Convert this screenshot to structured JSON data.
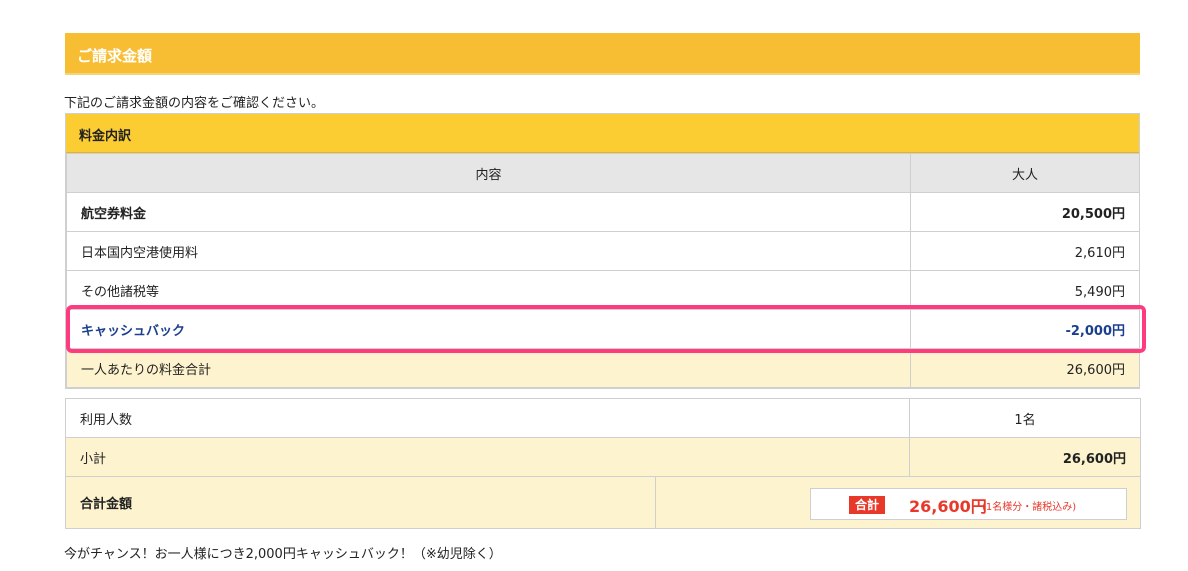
{
  "header": {
    "title": "ご請求金額"
  },
  "intro": "下記のご請求金額の内容をご確認ください。",
  "breakdown": {
    "section_title": "料金内訳",
    "col_content": "内容",
    "col_adult": "大人",
    "rows": [
      {
        "label": "航空券料金",
        "value": "20,500円"
      },
      {
        "label": "日本国内空港使用料",
        "value": "2,610円"
      },
      {
        "label": "その他諸税等",
        "value": "5,490円"
      },
      {
        "label": "キャッシュバック",
        "value": "-2,000円"
      },
      {
        "label": "一人あたりの料金合計",
        "value": "26,600円"
      }
    ]
  },
  "summary": {
    "count_label": "利用人数",
    "count_value": "1名",
    "subtotal_label": "小計",
    "subtotal_value": "26,600円",
    "grand_label": "合計金額",
    "grand_badge": "合計",
    "grand_amount": "26,600円",
    "grand_note": "(1名様分・諸税込み)"
  },
  "footer_note": "今がチャンス！お一人様につき2,000円キャッシュバック！（※幼児除く）",
  "colors": {
    "header": "#f8be33",
    "highlight": "#ff3b7f",
    "accent_red": "#e8382a",
    "cashback_blue": "#1b3f8f"
  }
}
